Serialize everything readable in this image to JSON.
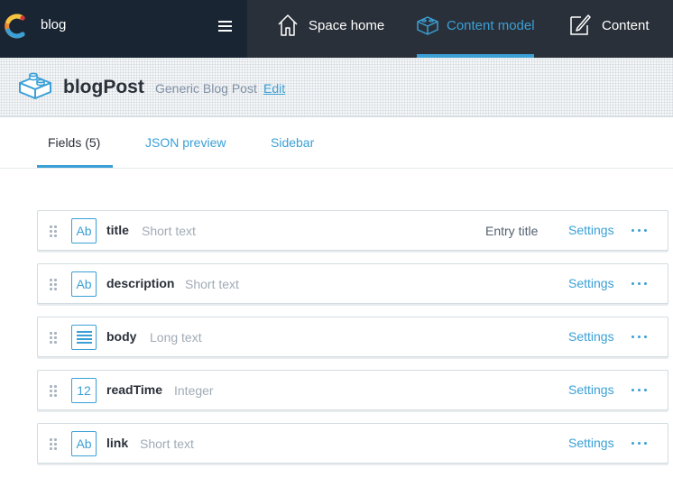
{
  "colors": {
    "nav_bg": "#2a3039",
    "space_bg": "#192532",
    "accent": "#3aa0d6",
    "logo_orange": "#e8853a"
  },
  "space": {
    "name": "blog",
    "logo_icon": "contentful-logo-icon",
    "menu_icon": "hamburger-icon"
  },
  "nav": {
    "items": [
      {
        "label": "Space home",
        "icon": "house-icon",
        "active": false
      },
      {
        "label": "Content model",
        "icon": "cube-icon",
        "active": true
      },
      {
        "label": "Content",
        "icon": "pen-document-icon",
        "active": false
      }
    ]
  },
  "content_type": {
    "icon": "lego-brick-icon",
    "name": "blogPost",
    "description": "Generic Blog Post",
    "edit_label": "Edit"
  },
  "tabs": [
    {
      "label": "Fields (5)",
      "active": true
    },
    {
      "label": "JSON preview",
      "active": false
    },
    {
      "label": "Sidebar",
      "active": false
    }
  ],
  "fields": [
    {
      "icon_text": "Ab",
      "icon": "short-text-icon",
      "name": "title",
      "type": "Short text",
      "entry_title": "Entry title",
      "settings_label": "Settings",
      "more_icon": "ellipsis-icon"
    },
    {
      "icon_text": "Ab",
      "icon": "short-text-icon",
      "name": "description",
      "type": "Short text",
      "entry_title": "",
      "settings_label": "Settings",
      "more_icon": "ellipsis-icon"
    },
    {
      "icon_text": "",
      "icon": "long-text-icon",
      "name": "body",
      "type": "Long text",
      "entry_title": "",
      "settings_label": "Settings",
      "more_icon": "ellipsis-icon"
    },
    {
      "icon_text": "12",
      "icon": "integer-icon",
      "name": "readTime",
      "type": "Integer",
      "entry_title": "",
      "settings_label": "Settings",
      "more_icon": "ellipsis-icon"
    },
    {
      "icon_text": "Ab",
      "icon": "short-text-icon",
      "name": "link",
      "type": "Short text",
      "entry_title": "",
      "settings_label": "Settings",
      "more_icon": "ellipsis-icon"
    }
  ]
}
